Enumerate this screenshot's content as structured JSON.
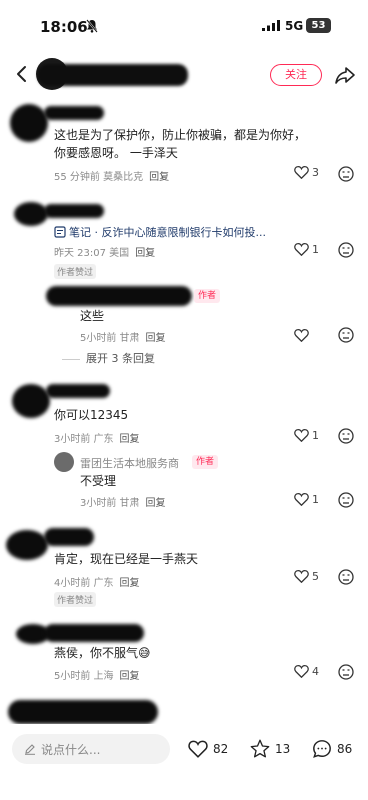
{
  "status": {
    "time": "18:06",
    "network": "5G",
    "battery": "53"
  },
  "nav": {
    "follow_label": "关注"
  },
  "comments": [
    {
      "text": "这也是为了保护你，防止你被骗，都是为你好，你要感恩呀。   一手泽天",
      "meta": "55 分钟前 莫桑比克",
      "reply": "回复",
      "likes": "3"
    },
    {
      "link": "笔记 · 反诈中心随意限制银行卡如何投...",
      "meta": "昨天 23:07 美国",
      "reply": "回复",
      "likes": "1",
      "tag": "作者赞过",
      "subreply": {
        "author_badge": "作者",
        "text": "这些",
        "meta": "5小时前 甘肃",
        "reply": "回复"
      },
      "expand": "展开 3 条回复"
    },
    {
      "text": "你可以12345",
      "meta": "3小时前 广东",
      "reply": "回复",
      "likes": "1",
      "subreply": {
        "name": "雷团生活本地服务商",
        "author_badge": "作者",
        "text": "不受理",
        "meta": "3小时前 甘肃",
        "reply": "回复",
        "likes": "1"
      }
    },
    {
      "text": "肯定，现在已经是一手燕天",
      "meta": "4小时前 广东",
      "reply": "回复",
      "likes": "5",
      "tag": "作者赞过"
    },
    {
      "text": "燕侯，你不服气😅",
      "meta": "5小时前 上海",
      "reply": "回复",
      "likes": "4"
    }
  ],
  "bottom": {
    "placeholder": "说点什么...",
    "likes": "82",
    "stars": "13",
    "comments": "86"
  }
}
